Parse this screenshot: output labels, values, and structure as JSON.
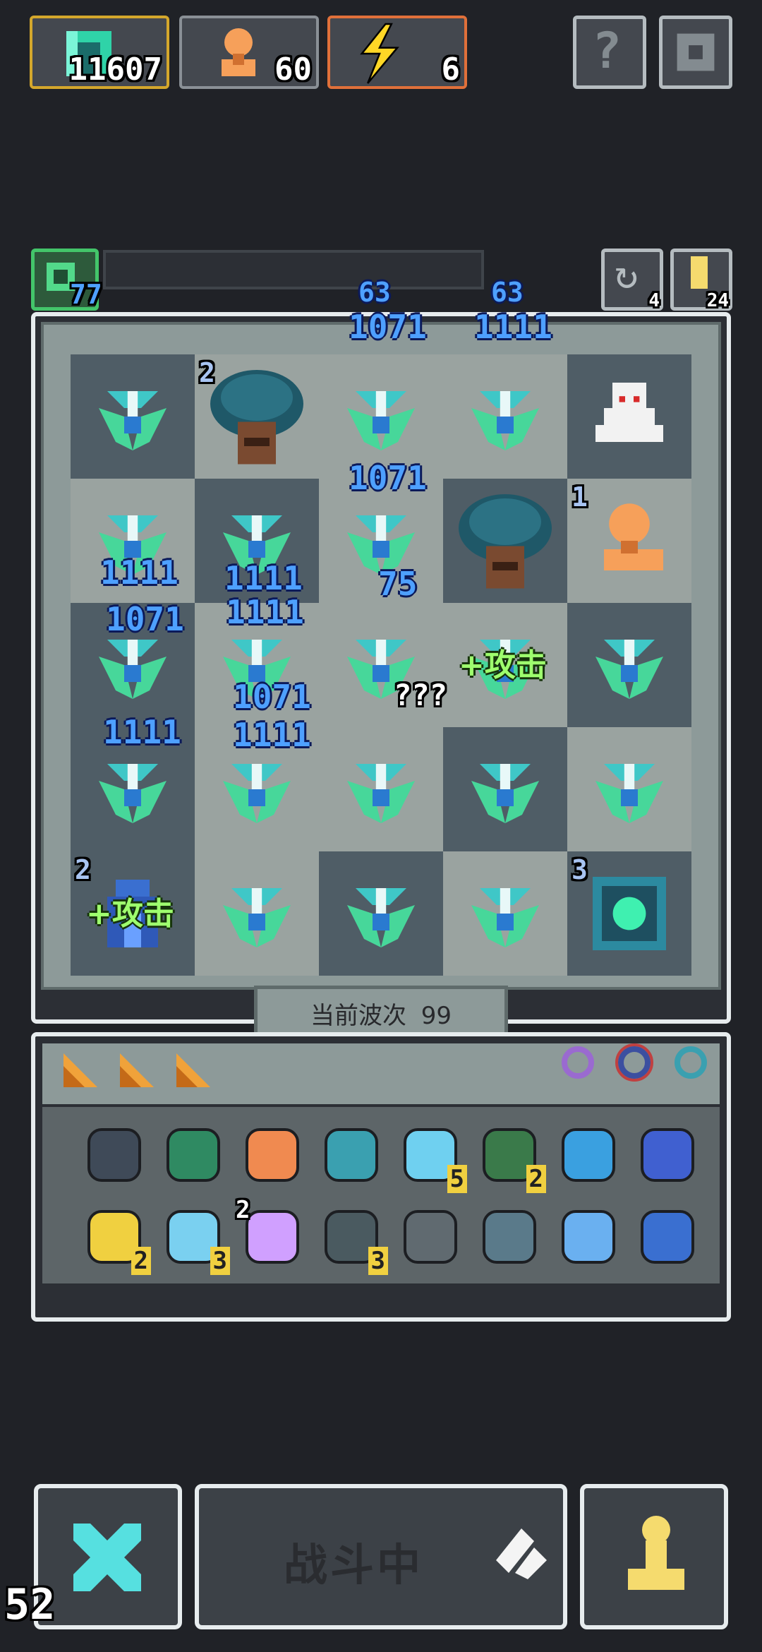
{
  "resources": {
    "gems": "11607",
    "units": "60",
    "energy": "6"
  },
  "colors": {
    "gem_box_border": "#d4a72c",
    "energy_box_border": "#e0703a",
    "accent_cyan": "#44d7d3",
    "field_bg": "#8d9a99",
    "enemy_blue": "#3a8fff"
  },
  "top_buttons": [
    "question-icon",
    "gear-icon"
  ],
  "field_status": {
    "level": "77",
    "left_counter": "4",
    "right_counter": "24"
  },
  "grid": {
    "cells": [
      {
        "id": "r1c1",
        "tone": "dark",
        "icon": "turret-icon"
      },
      {
        "id": "r1c2",
        "tone": "light",
        "icon": "tree-icon",
        "badge": "2"
      },
      {
        "id": "r1c3",
        "tone": "light",
        "icon": "turret-icon"
      },
      {
        "id": "r1c4",
        "tone": "light",
        "icon": "turret-icon"
      },
      {
        "id": "r1c5",
        "tone": "dark",
        "icon": "ghost-icon"
      },
      {
        "id": "r2c1",
        "tone": "light",
        "icon": "turret-icon"
      },
      {
        "id": "r2c2",
        "tone": "dark",
        "icon": "turret-icon"
      },
      {
        "id": "r2c3",
        "tone": "light",
        "icon": "turret-icon"
      },
      {
        "id": "r2c4",
        "tone": "dark",
        "icon": "tree-icon"
      },
      {
        "id": "r2c5",
        "tone": "light",
        "icon": "bust-icon",
        "badge": "1"
      },
      {
        "id": "r3c1",
        "tone": "dark",
        "icon": "turret-icon"
      },
      {
        "id": "r3c2",
        "tone": "light",
        "icon": "turret-icon"
      },
      {
        "id": "r3c3",
        "tone": "light",
        "icon": "turret-icon"
      },
      {
        "id": "r3c4",
        "tone": "light",
        "icon": "turret-icon",
        "label": "+攻击"
      },
      {
        "id": "r3c5",
        "tone": "dark",
        "icon": "turret-icon"
      },
      {
        "id": "r4c1",
        "tone": "dark",
        "icon": "turret-icon"
      },
      {
        "id": "r4c2",
        "tone": "light",
        "icon": "turret-icon"
      },
      {
        "id": "r4c3",
        "tone": "light",
        "icon": "turret-icon"
      },
      {
        "id": "r4c4",
        "tone": "dark",
        "icon": "turret-icon"
      },
      {
        "id": "r4c5",
        "tone": "light",
        "icon": "turret-icon"
      },
      {
        "id": "r5c1",
        "tone": "dark",
        "icon": "tower-icon",
        "badge": "2",
        "label": "+攻击"
      },
      {
        "id": "r5c2",
        "tone": "light",
        "icon": "turret-icon"
      },
      {
        "id": "r5c3",
        "tone": "dark",
        "icon": "turret-icon"
      },
      {
        "id": "r5c4",
        "tone": "light",
        "icon": "turret-icon"
      },
      {
        "id": "r5c5",
        "tone": "dark",
        "icon": "portal-icon",
        "badge": "3"
      }
    ],
    "damage_numbers": [
      "63",
      "63",
      "1071",
      "1111",
      "1071",
      "1111",
      "1111",
      "1071",
      "1111",
      "75",
      "1071",
      "1111",
      "1111"
    ],
    "unknown_label": "???"
  },
  "wave": {
    "label": "当前波次",
    "value": "99"
  },
  "inventory": {
    "tabs": [
      "triangle-icon",
      "triangle-icon",
      "triangle-icon"
    ],
    "rings": [
      "ring-purple-icon",
      "ring-red-icon",
      "ring-blue-icon"
    ],
    "row1": [
      {
        "icon": "shield-icon"
      },
      {
        "icon": "helmet-icon"
      },
      {
        "icon": "armor-icon"
      },
      {
        "icon": "amulet-icon"
      },
      {
        "icon": "orb-icon",
        "count": "5"
      },
      {
        "icon": "boot-icon",
        "count": "2"
      },
      {
        "icon": "gear-star-icon"
      },
      {
        "icon": "potion-icon"
      }
    ],
    "row2": [
      {
        "icon": "magnet-icon",
        "count": "2"
      },
      {
        "icon": "bird-icon",
        "count": "3"
      },
      {
        "icon": "spark-icon",
        "badge": "2"
      },
      {
        "icon": "chip-icon",
        "count": "3"
      },
      {
        "icon": "heart-core-icon"
      },
      {
        "icon": "basket-icon"
      },
      {
        "icon": "fish-icon"
      },
      {
        "icon": "coin-icon"
      }
    ]
  },
  "bottom": {
    "fight_label": "战斗中",
    "counter": "52"
  }
}
